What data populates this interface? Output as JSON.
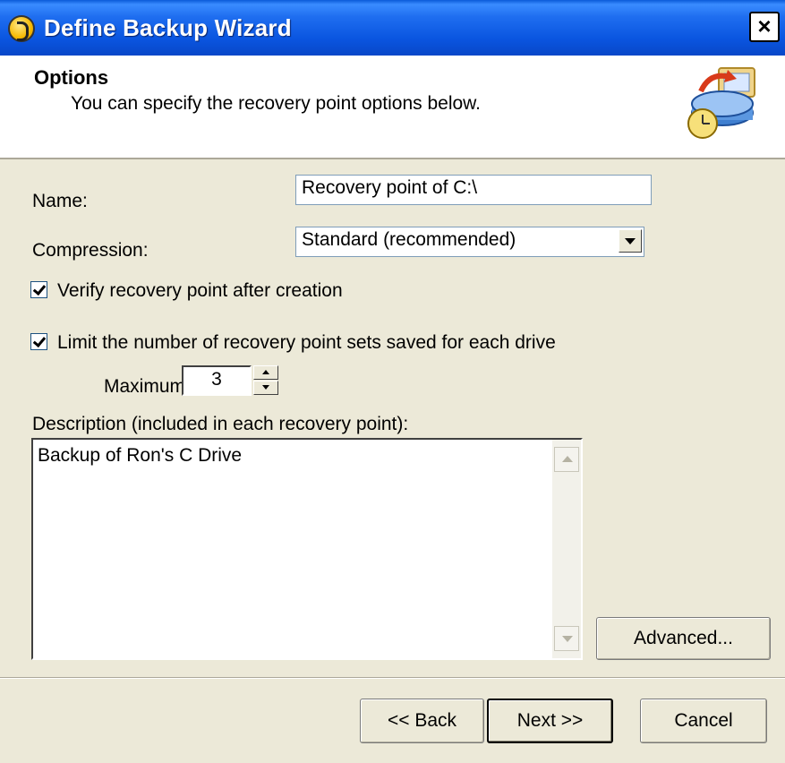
{
  "window": {
    "title": "Define Backup Wizard",
    "close_glyph": "×"
  },
  "header": {
    "title": "Options",
    "subtitle": "You can specify the recovery point options below.",
    "icon": "backup-drive-icon"
  },
  "form": {
    "name_label": "Name:",
    "name_value": "Recovery point of C:\\",
    "compression_label": "Compression:",
    "compression_value": "Standard (recommended)",
    "verify_label": "Verify recovery point after creation",
    "verify_checked": true,
    "limit_label": "Limit the number of recovery point sets saved for each drive",
    "limit_checked": true,
    "maximum_label": "Maximum:",
    "maximum_value": "3",
    "description_label": "Description (included in each recovery point):",
    "description_value": "Backup of Ron's C Drive"
  },
  "buttons": {
    "advanced": "Advanced...",
    "back": "<< Back",
    "next": "Next >>",
    "cancel": "Cancel"
  },
  "colors": {
    "titlebar": "#0a55e0",
    "dialog": "#ece9d8",
    "header_bg": "#ffffff"
  }
}
